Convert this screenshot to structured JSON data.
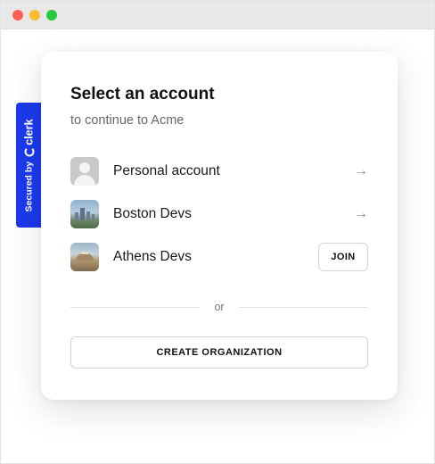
{
  "window": {
    "controls": [
      "close",
      "minimize",
      "maximize"
    ]
  },
  "badge": {
    "secured_by": "Secured by",
    "brand": "clerk",
    "color": "#1c3aed"
  },
  "card": {
    "title": "Select an account",
    "subtitle": "to continue to Acme"
  },
  "accounts": [
    {
      "name": "Personal account",
      "avatar": "person-placeholder",
      "action": "arrow-right-icon"
    },
    {
      "name": "Boston Devs",
      "avatar": "city-skyline-photo",
      "action": "arrow-right-icon"
    },
    {
      "name": "Athens Devs",
      "avatar": "acropolis-photo",
      "action_label": "JOIN"
    }
  ],
  "arrow_glyph": "→",
  "divider": {
    "text": "or"
  },
  "create_button": {
    "label": "CREATE ORGANIZATION"
  }
}
